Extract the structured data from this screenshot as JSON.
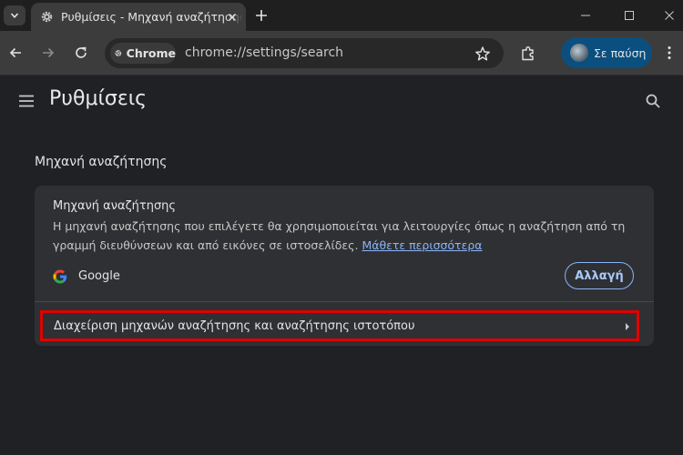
{
  "tab": {
    "title": "Ρυθμίσεις - Μηχανή αναζήτησης"
  },
  "omnibox": {
    "chip_label": "Chrome",
    "url": "chrome://settings/search"
  },
  "profile": {
    "label": "Σε παύση"
  },
  "header": {
    "title": "Ρυθμίσεις"
  },
  "section": {
    "title": "Μηχανή αναζήτησης"
  },
  "card": {
    "heading": "Μηχανή αναζήτησης",
    "description": "Η μηχανή αναζήτησης που επιλέγετε θα χρησιμοποιείται για λειτουργίες όπως η αναζήτηση από τη γραμμή διευθύνσεων και από εικόνες σε ιστοσελίδες.",
    "learn_more": "Μάθετε περισσότερα",
    "engine_name": "Google",
    "change_label": "Αλλαγή",
    "manage_label": "Διαχείριση μηχανών αναζήτησης και αναζήτησης ιστοτόπου"
  },
  "colors": {
    "accent": "#8ab4f8",
    "highlight_border": "#e00000",
    "profile_bg": "#0b4f7f"
  },
  "icons": [
    "chevron-down-icon",
    "gear-icon",
    "close-icon",
    "plus-icon",
    "minimize-icon",
    "maximize-icon",
    "back-icon",
    "forward-icon",
    "reload-icon",
    "chrome-icon",
    "star-icon",
    "extensions-icon",
    "avatar",
    "more-vert-icon",
    "hamburger-icon",
    "search-icon",
    "google-logo",
    "arrow-right-icon"
  ]
}
